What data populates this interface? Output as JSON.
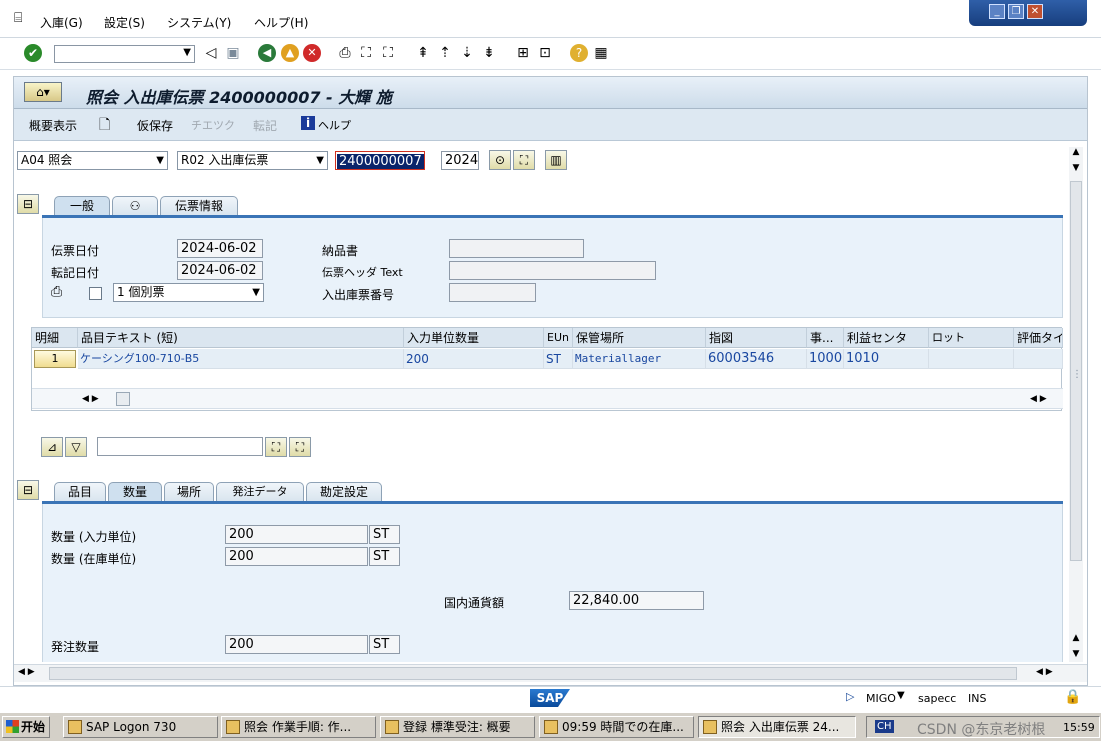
{
  "menu": {
    "items": [
      "入庫(G)",
      "設定(S)",
      "システム(Y)",
      "ヘルプ(H)"
    ]
  },
  "window_controls": {
    "minimize": "_",
    "restore": "❐",
    "close": "✕"
  },
  "toolbar": {
    "command_value": ""
  },
  "screen": {
    "title": "照会 入出庫伝票 2400000007 - 大輝 施"
  },
  "app_toolbar": {
    "overview": "概要表示",
    "hold": "仮保存",
    "check": "チエツク",
    "post": "転記",
    "help": "ヘルプ"
  },
  "header": {
    "action": "A04 照会",
    "refdoc": "R02 入出庫伝票",
    "doc_number": "2400000007",
    "year": "2024"
  },
  "header_tabs": [
    "一般",
    "",
    "伝票情報"
  ],
  "general": {
    "doc_date_label": "伝票日付",
    "doc_date": "2024-06-02",
    "post_date_label": "転記日付",
    "post_date": "2024-06-02",
    "print_option": "1 個別票",
    "delivery_note_label": "納品書",
    "header_text_label": "伝票ヘッダ Text",
    "slip_no_label": "入出庫票番号"
  },
  "table": {
    "columns": [
      "明細",
      "品目テキスト (短)",
      "入力単位数量",
      "EUn",
      "保管場所",
      "指図",
      "事...",
      "利益センタ",
      "ロット",
      "評価タイ"
    ],
    "rows": [
      {
        "line": "1",
        "text": "ケーシング100-710-B5",
        "qty": "200",
        "unit": "ST",
        "sloc": "Materiallager",
        "order": "60003546",
        "plant": "1000",
        "profit": "1010",
        "batch": "",
        "val": ""
      }
    ]
  },
  "detail_tabs": [
    "品目",
    "数量",
    "場所",
    "発注データ",
    "勘定設定"
  ],
  "quantity": {
    "qty_entry_label": "数量 (入力単位)",
    "qty_entry": "200",
    "qty_entry_unit": "ST",
    "qty_stock_label": "数量 (在庫単位)",
    "qty_stock": "200",
    "qty_stock_unit": "ST",
    "amount_label": "国内通貨額",
    "amount": "22,840.00",
    "po_qty_label": "発注数量",
    "po_qty": "200",
    "po_qty_unit": "ST"
  },
  "status": {
    "tcode": "MIGO",
    "server": "sapecc",
    "mode": "INS",
    "logo": "SAP"
  },
  "taskbar": {
    "start": "开始",
    "tasks": [
      "SAP Logon 730",
      "照会 作業手順: 作...",
      "登録 標準受注: 概要",
      "09:59 時間での在庫...",
      "照会 入出庫伝票 24..."
    ],
    "lang": "CH",
    "clock": "15:59",
    "watermark": "CSDN @东京老树根"
  }
}
